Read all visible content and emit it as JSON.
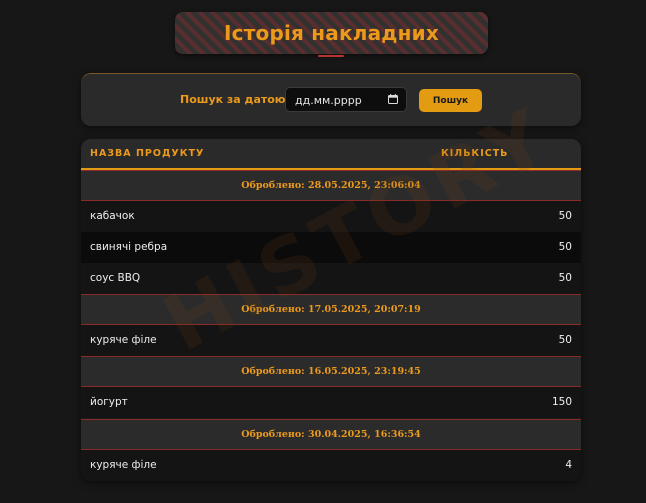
{
  "page": {
    "title": "Історія накладних",
    "watermark": "HISTORY"
  },
  "search": {
    "label": "Пошук за датою:",
    "date_value": "дд.мм.рррр",
    "button_label": "Пошук"
  },
  "table": {
    "headers": {
      "product": "НАЗВА ПРОДУКТУ",
      "quantity": "КІЛЬКІСТЬ"
    },
    "groups": [
      {
        "processed": "Оброблено: 28.05.2025, 23:06:04",
        "items": [
          {
            "name": "кабачок",
            "qty": "50"
          },
          {
            "name": "свинячі ребра",
            "qty": "50"
          },
          {
            "name": "соус BBQ",
            "qty": "50"
          }
        ]
      },
      {
        "processed": "Оброблено: 17.05.2025, 20:07:19",
        "items": [
          {
            "name": "куряче філе",
            "qty": "50"
          }
        ]
      },
      {
        "processed": "Оброблено: 16.05.2025, 23:19:45",
        "items": [
          {
            "name": "йогурт",
            "qty": "150"
          }
        ]
      },
      {
        "processed": "Оброблено: 30.04.2025, 16:36:54",
        "items": [
          {
            "name": "куряче філе",
            "qty": "4"
          }
        ]
      }
    ]
  },
  "colors": {
    "accent": "#e39b12",
    "title": "#ec9a1c",
    "background": "#171717",
    "group_border": "#8a2a2a"
  },
  "icons": {
    "date_picker": "calendar-icon"
  }
}
